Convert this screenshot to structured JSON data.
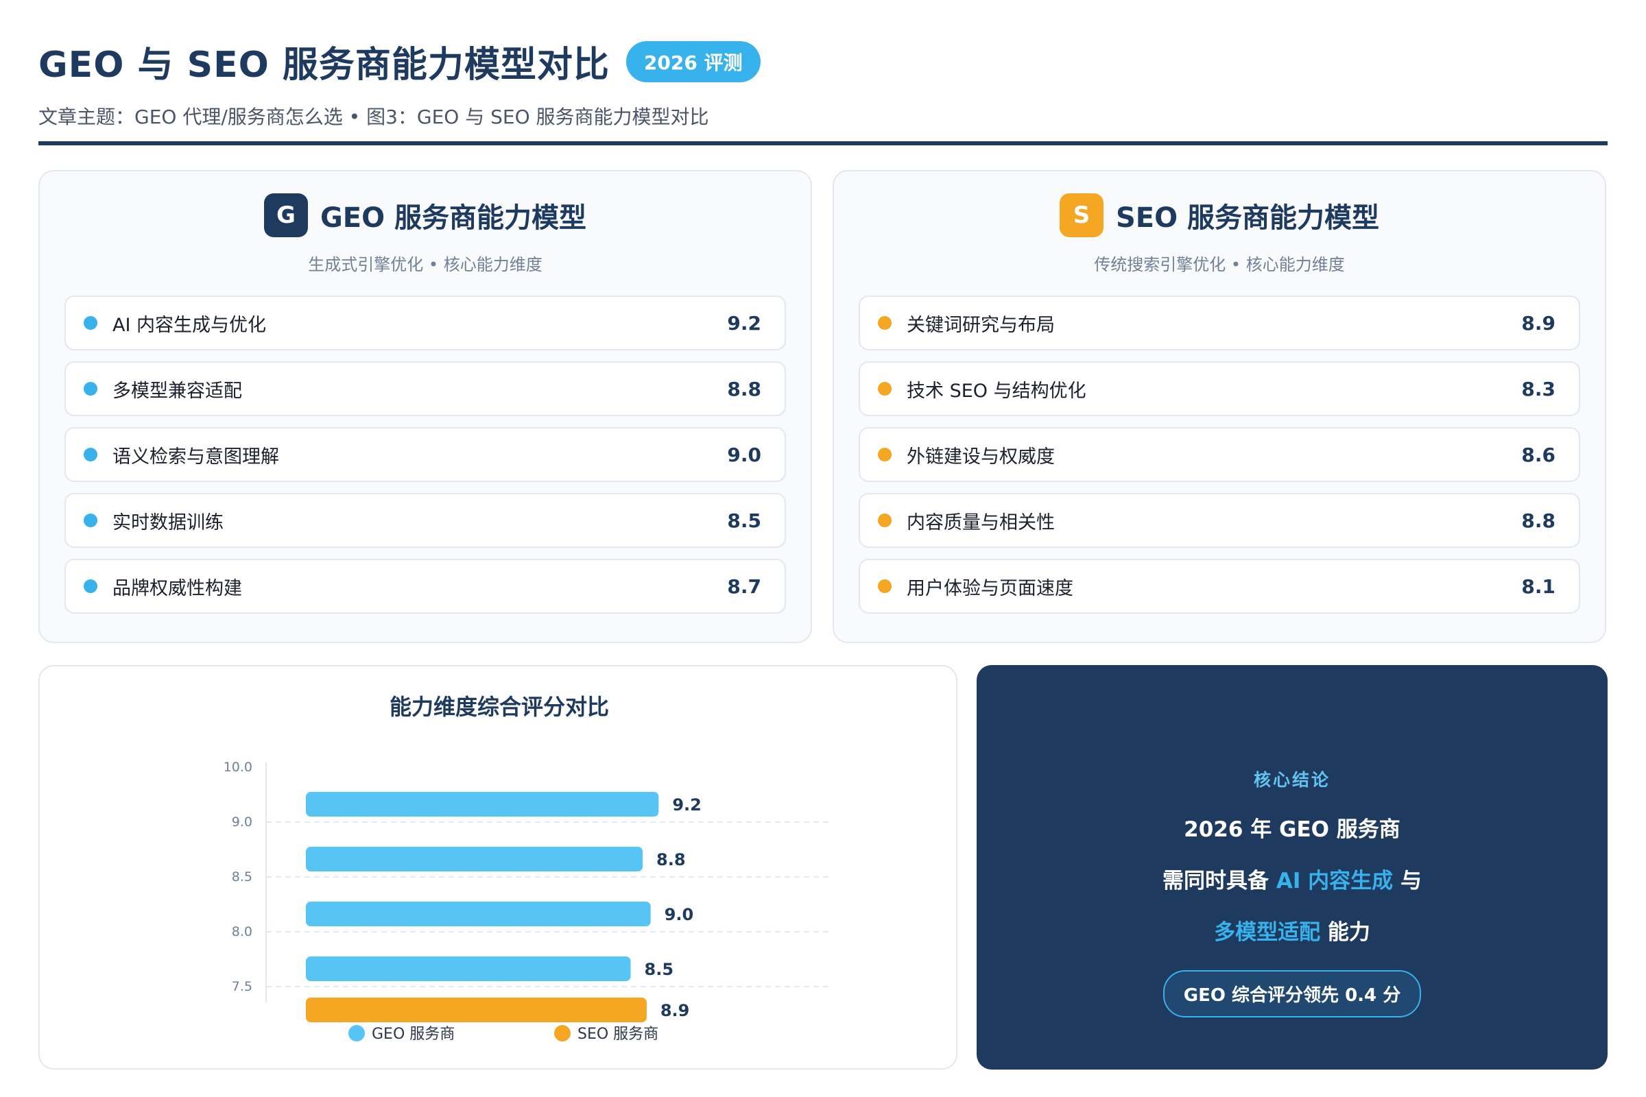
{
  "header": {
    "title": "GEO 与 SEO 服务商能力模型对比",
    "badge": "2026 评测",
    "subtitle": "文章主题：GEO 代理/服务商怎么选 • 图3：GEO 与 SEO 服务商能力模型对比"
  },
  "geo_panel": {
    "icon_letter": "G",
    "title": "GEO 服务商能力模型",
    "subtitle": "生成式引擎优化 • 核心能力维度",
    "items": [
      {
        "label": "AI 内容生成与优化",
        "score": "9.2"
      },
      {
        "label": "多模型兼容适配",
        "score": "8.8"
      },
      {
        "label": "语义检索与意图理解",
        "score": "9.0"
      },
      {
        "label": "实时数据训练",
        "score": "8.5"
      },
      {
        "label": "品牌权威性构建",
        "score": "8.7"
      }
    ]
  },
  "seo_panel": {
    "icon_letter": "S",
    "title": "SEO 服务商能力模型",
    "subtitle": "传统搜索引擎优化 • 核心能力维度",
    "items": [
      {
        "label": "关键词研究与布局",
        "score": "8.9"
      },
      {
        "label": "技术 SEO 与结构优化",
        "score": "8.3"
      },
      {
        "label": "外链建设与权威度",
        "score": "8.6"
      },
      {
        "label": "内容质量与相关性",
        "score": "8.8"
      },
      {
        "label": "用户体验与页面速度",
        "score": "8.1"
      }
    ]
  },
  "chart_data": {
    "type": "bar",
    "orientation": "horizontal",
    "title": "能力维度综合评分对比",
    "y_ticks": [
      "10.0",
      "9.0",
      "8.5",
      "8.0",
      "7.5"
    ],
    "bars": [
      {
        "series": "GEO 服务商",
        "value": 9.2,
        "label": "9.2"
      },
      {
        "series": "GEO 服务商",
        "value": 8.8,
        "label": "8.8"
      },
      {
        "series": "GEO 服务商",
        "value": 9.0,
        "label": "9.0"
      },
      {
        "series": "GEO 服务商",
        "value": 8.5,
        "label": "8.5"
      },
      {
        "series": "SEO 服务商",
        "value": 8.9,
        "label": "8.9"
      }
    ],
    "series": [
      {
        "name": "GEO 服务商",
        "color": "#56c5f5"
      },
      {
        "name": "SEO 服务商",
        "color": "#f5a623"
      }
    ],
    "grid": true,
    "legend": "bottom"
  },
  "conclusion": {
    "label": "核心结论",
    "line1": "2026 年 GEO 服务商",
    "line2_pre": "需同时具备 ",
    "line2_hl": "AI 内容生成",
    "line2_post": " 与",
    "line3_hl": "多模型适配",
    "line3_post": " 能力",
    "pill": "GEO 综合评分领先 0.4 分"
  }
}
